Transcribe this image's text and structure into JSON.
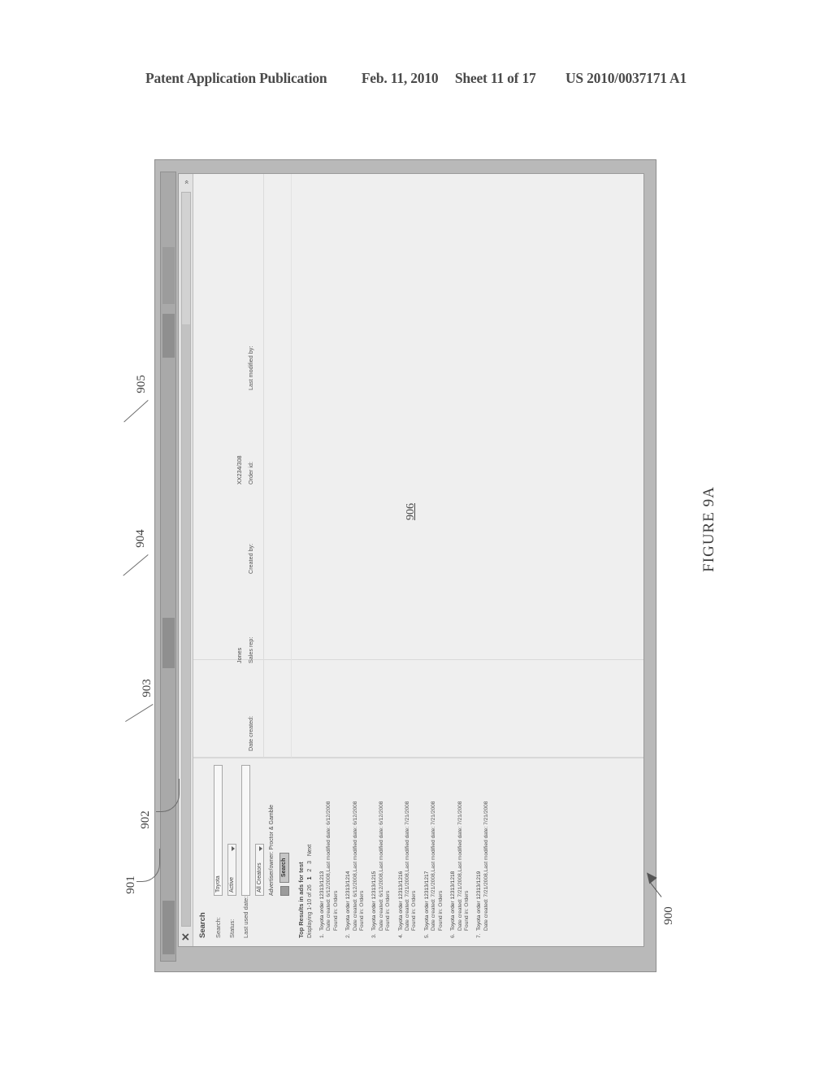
{
  "patent_header": {
    "publication": "Patent Application Publication",
    "date": "Feb. 11, 2010",
    "sheet": "Sheet 11 of 17",
    "number": "US 2010/0037171 A1"
  },
  "figure": {
    "label": "FIGURE 9A",
    "root_ref": "900",
    "refs": {
      "r901": "901",
      "r902": "902",
      "r903": "903",
      "r904": "904",
      "r905": "905",
      "r906": "906"
    }
  },
  "window": {
    "close_icon": "✕",
    "scroll_icon": "»"
  },
  "search_panel": {
    "title": "Search",
    "fields": [
      {
        "label": "Search:",
        "value": "Toyota",
        "type": "text"
      },
      {
        "label": "Status:",
        "value": "Active",
        "type": "select"
      },
      {
        "label": "Last used date:",
        "value": "",
        "type": "text"
      }
    ],
    "owner_row": {
      "select_value": "All Creators",
      "note": "Advertiser/owner:  Proctor & Gamble"
    },
    "search_button": "Search",
    "results_header": "Top Results in ads for test",
    "paging": {
      "text": "Displaying 1-10  of 26",
      "pages": [
        "1",
        "2",
        "3"
      ],
      "next": "Next"
    },
    "results": [
      {
        "num": "1.",
        "title": "Toyota order 12313/1213",
        "meta": "Date created: 6/12/2008,Last modified date: 6/12/2008",
        "found": "Found in: Orders"
      },
      {
        "num": "2.",
        "title": "Toyota order 12313/1214",
        "meta": "Date created: 6/12/2008,Last modified date: 6/12/2008",
        "found": "Found in: Orders"
      },
      {
        "num": "3.",
        "title": "Toyota order 12313/1215",
        "meta": "Date created: 6/12/2008,Last modified date: 6/12/2008",
        "found": "Found in: Orders"
      },
      {
        "num": "4.",
        "title": "Toyota order 12313/1216",
        "meta": "Date created: 7/21/2008,Last modified date: 7/21/2008",
        "found": "Found in: Orders"
      },
      {
        "num": "5.",
        "title": "Toyota order 12313/1217",
        "meta": "Date created: 7/21/2008,Last modified date: 7/21/2008",
        "found": "Found in: Orders"
      },
      {
        "num": "6.",
        "title": "Toyota order 12313/1218",
        "meta": "Date created: 7/21/2008,Last modified date: 7/21/2008",
        "found": "Found in: Orders"
      },
      {
        "num": "7.",
        "title": "Toyota order 12313/1219",
        "meta": "Date created: 7/21/2008,Last modified date: 7/21/2008",
        "found": ""
      }
    ]
  },
  "grid": {
    "columns": [
      {
        "label": "Date created:",
        "value": ""
      },
      {
        "label": "Sales rep:",
        "value": "Jones"
      },
      {
        "label": "Created by:",
        "value": ""
      },
      {
        "label": "Order id:",
        "value": "XX234/308"
      },
      {
        "label": "Last modified by:",
        "value": ""
      }
    ],
    "center_ref": "906"
  }
}
